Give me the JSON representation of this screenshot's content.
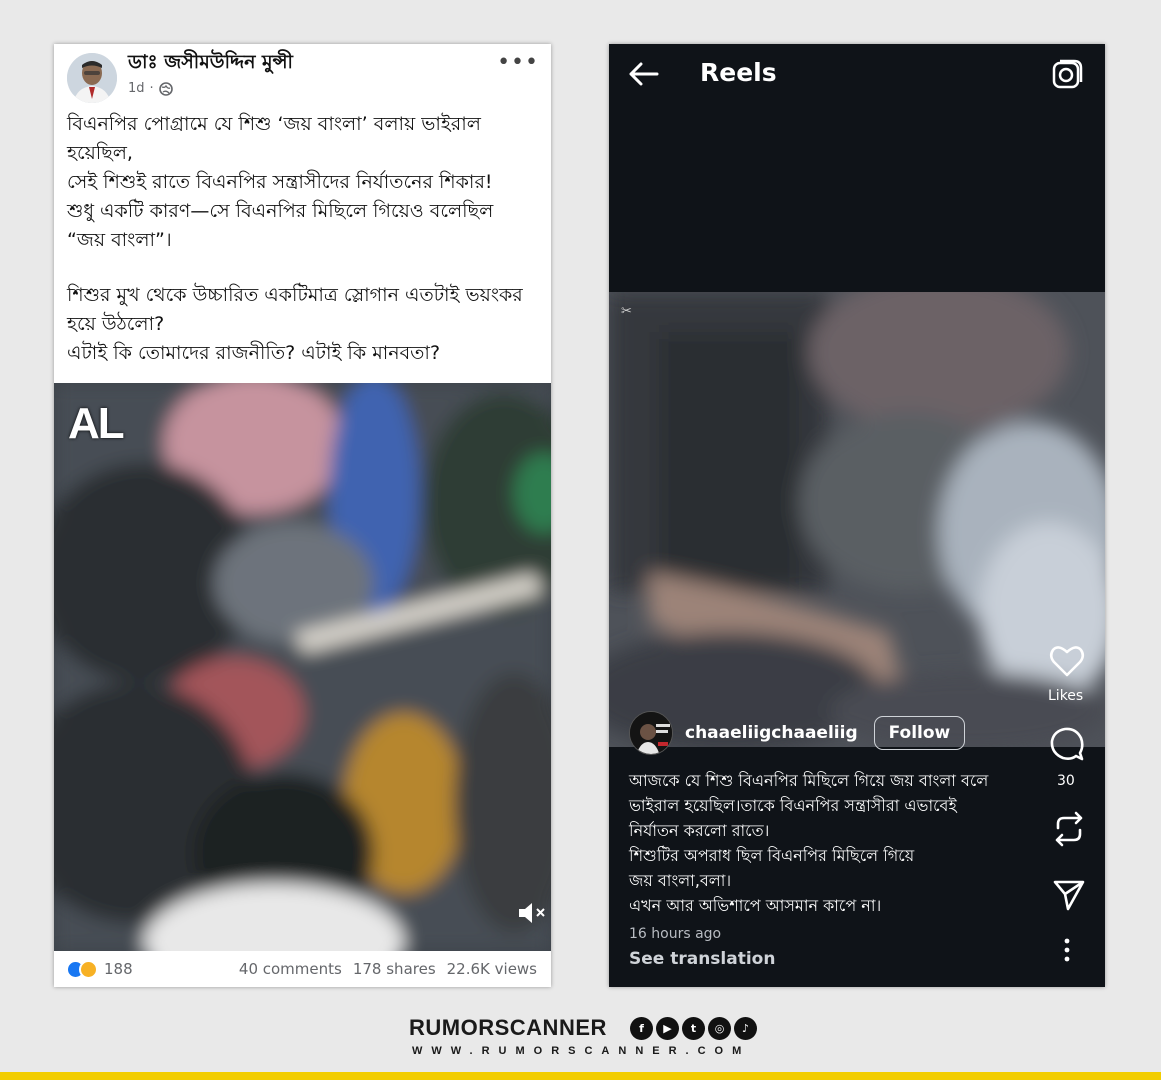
{
  "facebook_post": {
    "author": "ডাঃ জসীমউদ্দিন মুন্সী",
    "time": "1d",
    "privacy_icon": "globe-icon",
    "more_icon": "ellipsis-icon",
    "paragraphs": [
      "বিএনপির পোগ্রামে যে শিশু ‘জয় বাংলা’ বলায় ভাইরাল হয়েছিল,",
      "সেই শিশুই রাতে বিএনপির সন্ত্রাসীদের নির্যাতনের শিকার!",
      "শুধু একটি কারণ—সে বিএনপির মিছিলে গিয়েও বলেছিল “জয় বাংলা”।",
      "শিশুর মুখ থেকে উচ্চারিত একটিমাত্র স্লোগান এতটাই ভয়ংকর হয়ে উঠলো?",
      "এটাই কি তোমাদের রাজনীতি? এটাই কি মানবতা?"
    ],
    "video_watermark": "AL",
    "mute_icon": "muted-speaker-icon",
    "reaction_count": "188",
    "comments": "40 comments",
    "shares": "178 shares",
    "views": "22.6K views",
    "reaction_icons": [
      "like-reaction-icon",
      "sad-reaction-icon"
    ]
  },
  "reels": {
    "back_icon": "arrow-left-icon",
    "title": "Reels",
    "camera_icon": "camera-icon",
    "capcut_icon": "capcut-icon",
    "username": "chaaeliigchaaeliig",
    "follow_label": "Follow",
    "caption_lines": [
      "আজকে যে শিশু বিএনপির মিছিলে গিয়ে জয় বাংলা বলে",
      "ভাইরাল হয়েছিল।তাকে বিএনপির সন্ত্রাসীরা এভাবেই",
      "নির্যাতন করলো রাতে।",
      "শিশুটির অপরাধ ছিল বিএনপির মিছিলে গিয়ে",
      "জয় বাংলা,বলা।",
      "এখন আর অভিশাপে আসমান কাপে না।"
    ],
    "time_ago": "16 hours ago",
    "see_translation": "See translation",
    "likes_label": "Likes",
    "comment_count": "30",
    "side_icons": [
      "heart-icon",
      "comment-icon",
      "repost-icon",
      "share-icon",
      "more-vertical-icon"
    ]
  },
  "branding": {
    "name": "RUMORSCANNER",
    "url": "WWW.RUMORSCANNER.COM",
    "social_icons": [
      "facebook-icon",
      "youtube-icon",
      "twitter-icon",
      "instagram-icon",
      "tiktok-icon"
    ],
    "accent_color": "#f2cd00"
  }
}
